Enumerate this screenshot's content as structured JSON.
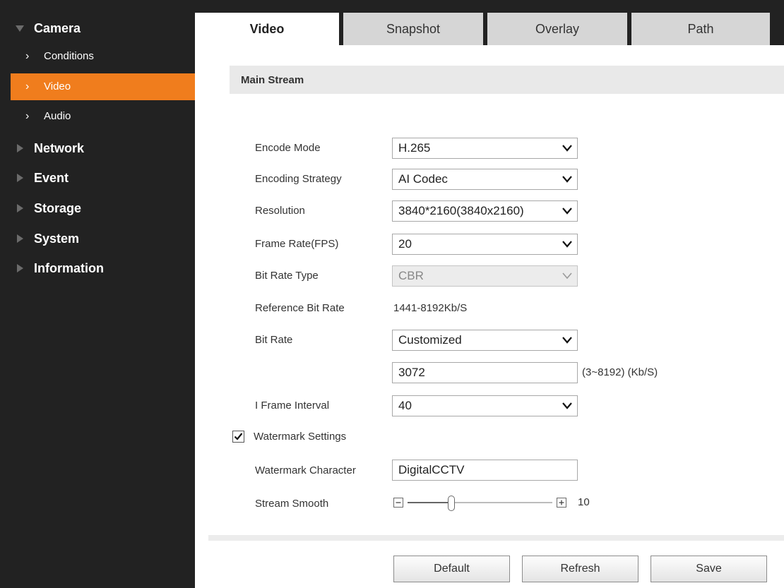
{
  "sidebar": {
    "camera": "Camera",
    "items": [
      {
        "label": "Conditions"
      },
      {
        "label": "Video"
      },
      {
        "label": "Audio"
      }
    ],
    "sections": [
      {
        "label": "Network"
      },
      {
        "label": "Event"
      },
      {
        "label": "Storage"
      },
      {
        "label": "System"
      },
      {
        "label": "Information"
      }
    ],
    "active_item": "Video",
    "accent_color": "#f07d1d"
  },
  "tabs": [
    {
      "label": "Video",
      "active": true
    },
    {
      "label": "Snapshot",
      "active": false
    },
    {
      "label": "Overlay",
      "active": false
    },
    {
      "label": "Path",
      "active": false
    }
  ],
  "main": {
    "section_title": "Main Stream",
    "encode_mode": {
      "label": "Encode Mode",
      "value": "H.265"
    },
    "encoding_strategy": {
      "label": "Encoding Strategy",
      "value": "AI Codec"
    },
    "resolution": {
      "label": "Resolution",
      "value": "3840*2160(3840x2160)"
    },
    "frame_rate": {
      "label": "Frame Rate(FPS)",
      "value": "20"
    },
    "bit_rate_type": {
      "label": "Bit Rate Type",
      "value": "CBR",
      "disabled": true
    },
    "reference_bit_rate": {
      "label": "Reference Bit Rate",
      "value": "1441-8192Kb/S"
    },
    "bit_rate": {
      "label": "Bit Rate",
      "value": "Customized",
      "custom_value": "3072",
      "range": "(3~8192) (Kb/S)"
    },
    "i_frame_interval": {
      "label": "I Frame Interval",
      "value": "40"
    },
    "watermark": {
      "label": "Watermark Settings",
      "checked": true
    },
    "watermark_character": {
      "label": "Watermark Character",
      "value": "DigitalCCTV"
    },
    "stream_smooth": {
      "label": "Stream Smooth",
      "value": "10",
      "level": 0.3
    }
  },
  "buttons": {
    "default": "Default",
    "refresh": "Refresh",
    "save": "Save"
  }
}
